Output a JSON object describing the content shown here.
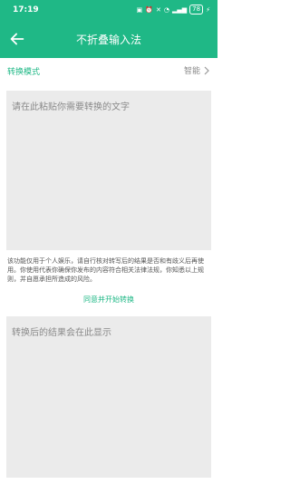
{
  "status": {
    "time": "17:19",
    "battery": "78"
  },
  "appbar": {
    "title": "不折叠输入法"
  },
  "mode": {
    "label": "转换模式",
    "value": "智能"
  },
  "input": {
    "placeholder": "请在此粘贴你需要转换的文字"
  },
  "disclaimer": "该功能仅用于个人娱乐，请自行核对转写后的结果是否和有歧义后再使用。你使用代表你确保你发布的内容符合相关法律法规，你知悉以上规则，并自愿承担所造成的风险。",
  "agree_button": "同意并开始转换",
  "output": {
    "placeholder": "转换后的结果会在此显示"
  },
  "colors": {
    "accent": "#1fb886",
    "box_bg": "#ebebeb"
  }
}
